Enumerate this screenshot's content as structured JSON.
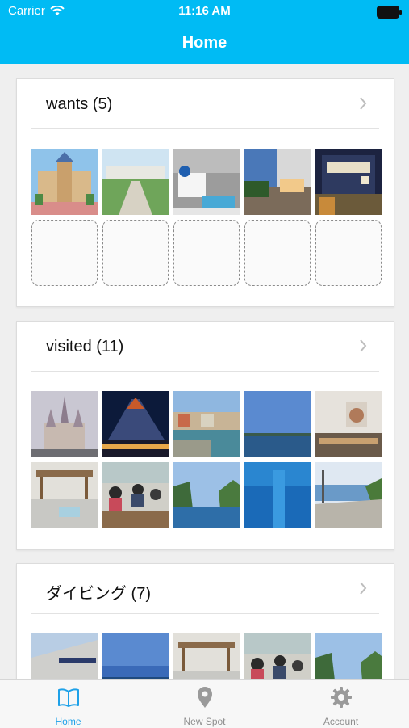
{
  "status_bar": {
    "carrier": "Carrier",
    "time": "11:16 AM"
  },
  "nav": {
    "title": "Home"
  },
  "sections": [
    {
      "title": "wants (5)",
      "photos": [
        "resort-castle-hotel",
        "seaside-hotel-garden",
        "white-terrace-pool",
        "hotel-terrace-deck",
        "lit-restaurant-sign"
      ],
      "empty_slots": 5
    },
    {
      "title": "visited (11)",
      "photos": [
        "castle-sunset",
        "volcano-night",
        "harbor-town",
        "calm-bay",
        "cafe-interior",
        "wooden-deck-dock",
        "group-dining",
        "rocky-cove",
        "underwater-blue",
        "coastal-road"
      ],
      "empty_slots": 0
    },
    {
      "title": "ダイビング (7)",
      "photos": [
        "dive-shop-building",
        "blue-sky-sea",
        "wooden-deck-dock",
        "group-dining",
        "rocky-cove"
      ],
      "empty_slots": 0
    }
  ],
  "tabs": [
    {
      "label": "Home",
      "icon": "book-icon",
      "active": true
    },
    {
      "label": "New Spot",
      "icon": "location-pin-icon",
      "active": false
    },
    {
      "label": "Account",
      "icon": "gear-icon",
      "active": false
    }
  ],
  "colors": {
    "accent": "#00bbf4",
    "tab_active": "#1ea1e8",
    "tab_inactive": "#8e8e8e"
  }
}
